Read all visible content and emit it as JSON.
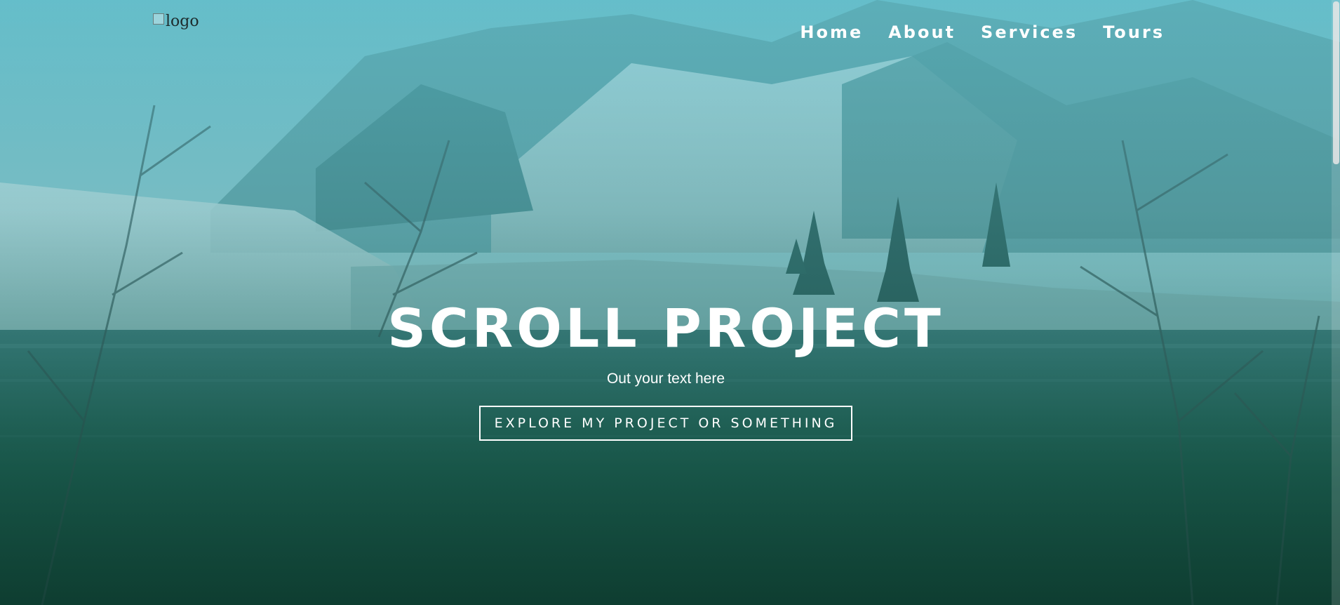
{
  "brand": {
    "logo_alt": "logo"
  },
  "nav": {
    "items": [
      {
        "label": "Home"
      },
      {
        "label": "About"
      },
      {
        "label": "Services"
      },
      {
        "label": "Tours"
      }
    ]
  },
  "hero": {
    "title": "SCROLL PROJECT",
    "subtitle": "Out your text here",
    "cta_label": "EXPLORE MY PROJECT OR SOMETHING"
  },
  "colors": {
    "overlay_top": "#50b4c3",
    "overlay_bottom": "#0a3c32",
    "text": "#ffffff"
  }
}
